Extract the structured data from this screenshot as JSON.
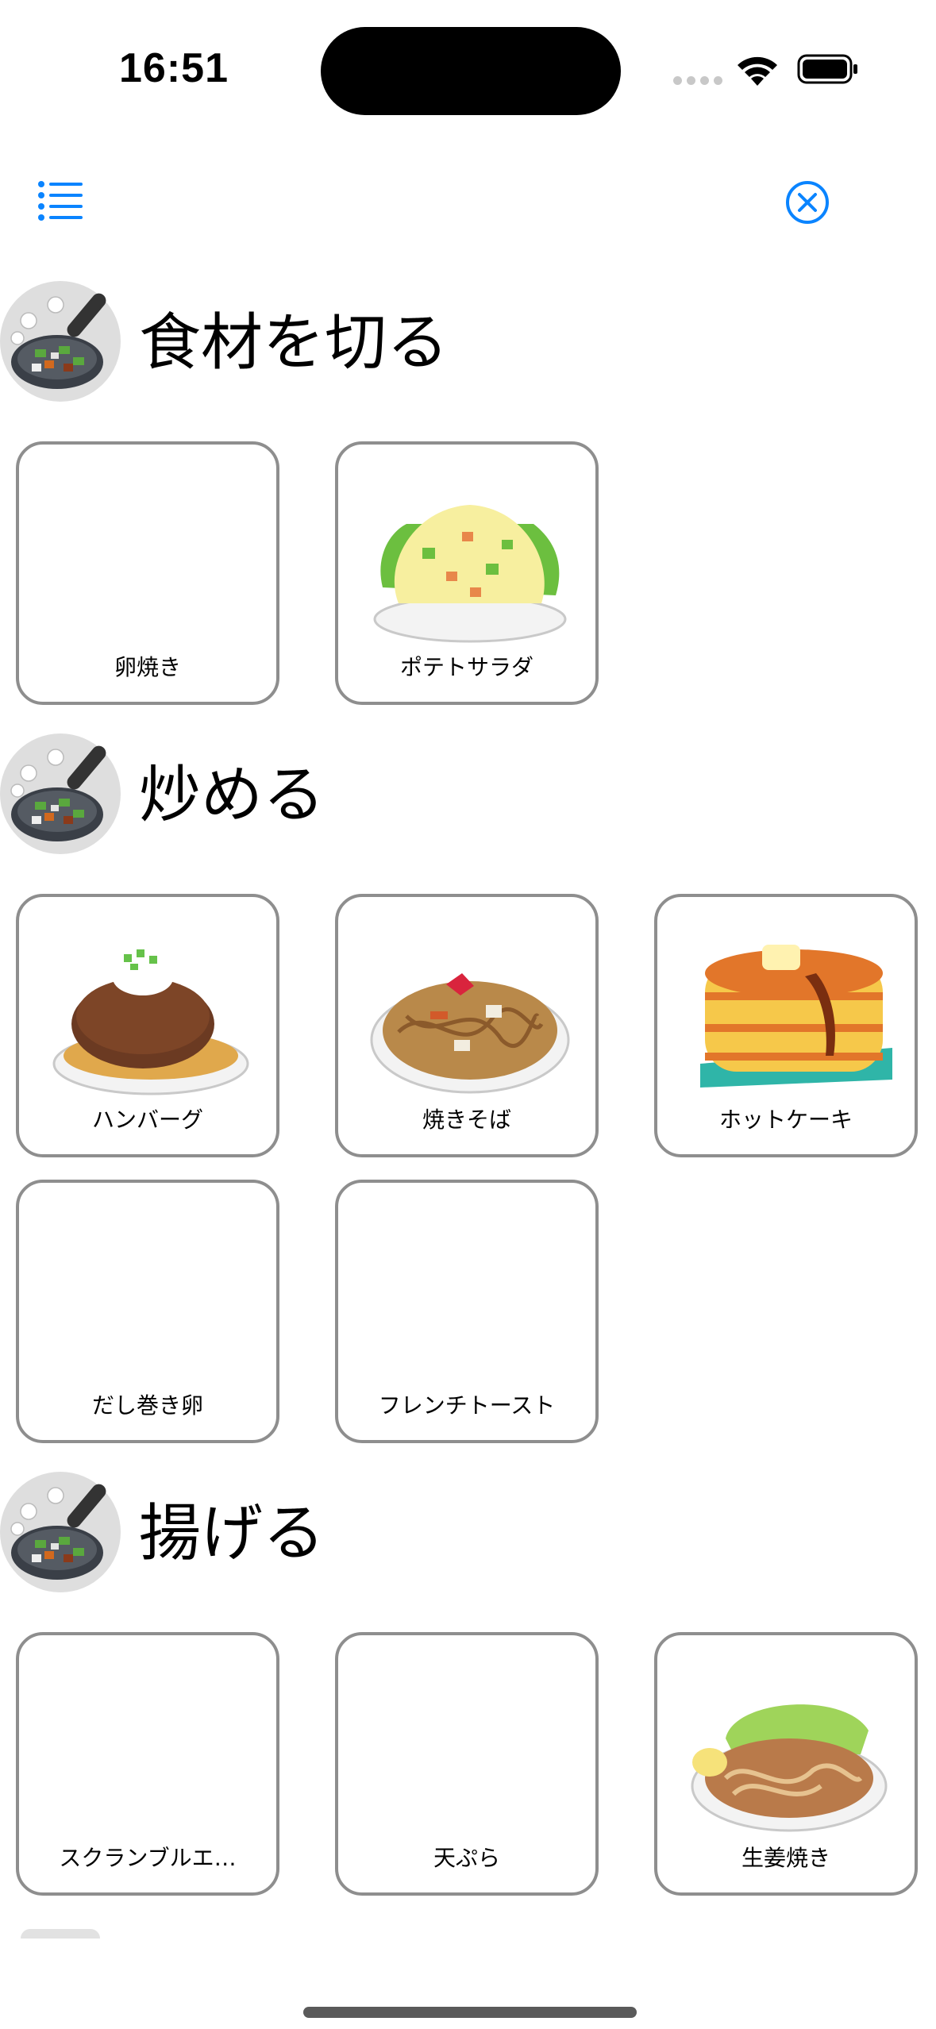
{
  "status_bar": {
    "time": "16:51"
  },
  "nav": {
    "list_icon": "list-bullet-icon",
    "close_icon": "xmark-circle-icon"
  },
  "accent": "#0a84ff",
  "sections": [
    {
      "title": "食材を切る",
      "icon": "frying-pan-icon",
      "items": [
        {
          "label": "卵焼き",
          "image": "none"
        },
        {
          "label": "ポテトサラダ",
          "image": "potato-salad-illustration"
        }
      ]
    },
    {
      "title": "炒める",
      "icon": "frying-pan-icon",
      "items": [
        {
          "label": "ハンバーグ",
          "image": "hamburg-steak-illustration"
        },
        {
          "label": "焼きそば",
          "image": "yakisoba-illustration"
        },
        {
          "label": "ホットケーキ",
          "image": "pancake-illustration"
        },
        {
          "label": "だし巻き卵",
          "image": "none"
        },
        {
          "label": "フレンチトースト",
          "image": "none"
        }
      ]
    },
    {
      "title": "揚げる",
      "icon": "frying-pan-icon",
      "items": [
        {
          "label": "スクランブルエ…",
          "image": "none"
        },
        {
          "label": "天ぷら",
          "image": "none"
        },
        {
          "label": "生姜焼き",
          "image": "ginger-pork-illustration"
        }
      ]
    }
  ]
}
